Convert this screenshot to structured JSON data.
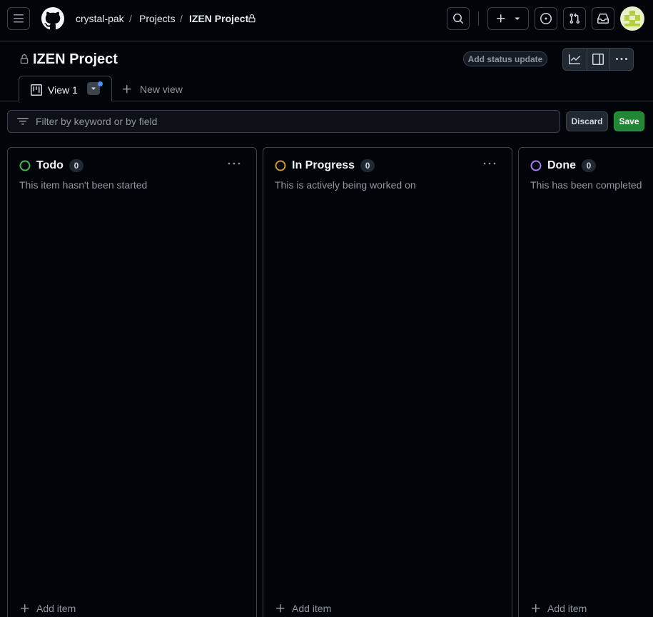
{
  "header": {
    "breadcrumbs": [
      {
        "label": "crystal-pak"
      },
      {
        "label": "Projects"
      },
      {
        "label": "IZEN Project"
      }
    ],
    "separator": "/"
  },
  "project": {
    "title": "IZEN Project",
    "status_update_label": "Add status update"
  },
  "tabs": {
    "active_label": "View 1",
    "new_view_label": "New view"
  },
  "filter": {
    "placeholder": "Filter by keyword or by field",
    "discard_label": "Discard",
    "save_label": "Save"
  },
  "columns": [
    {
      "name": "Todo",
      "count": "0",
      "description": "This item hasn't been started",
      "color": "#3fb950",
      "add_label": "Add item"
    },
    {
      "name": "In Progress",
      "count": "0",
      "description": "This is actively being worked on",
      "color": "#d29922",
      "add_label": "Add item"
    },
    {
      "name": "Done",
      "count": "0",
      "description": "This has been completed",
      "color": "#ab7df8",
      "add_label": "Add item"
    }
  ],
  "colors": {
    "accent_green": "#238636",
    "accent_blue": "#4493f8",
    "background": "#010409"
  }
}
